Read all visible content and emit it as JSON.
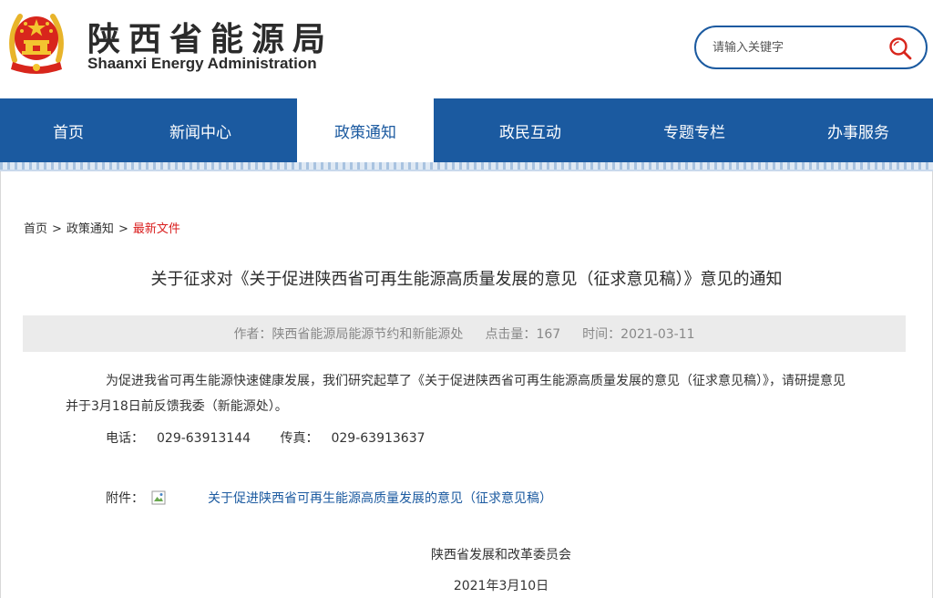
{
  "header": {
    "title": "陕西省能源局",
    "subtitle": "Shaanxi Energy Administration",
    "emblem_icon": "national-emblem-icon"
  },
  "search": {
    "placeholder": "请输入关键字",
    "icon": "search-icon"
  },
  "nav": {
    "items": [
      {
        "label": "首页",
        "active": false
      },
      {
        "label": "新闻中心",
        "active": false
      },
      {
        "label": "政策通知",
        "active": true
      },
      {
        "label": "政民互动",
        "active": false
      },
      {
        "label": "专题专栏",
        "active": false
      },
      {
        "label": "办事服务",
        "active": false
      }
    ]
  },
  "breadcrumb": {
    "items": [
      "首页",
      "政策通知"
    ],
    "separator": ">",
    "current": "最新文件"
  },
  "article": {
    "title": "关于征求对《关于促进陕西省可再生能源高质量发展的意见（征求意见稿）》意见的通知",
    "meta": {
      "author_label": "作者：",
      "author": "陕西省能源局能源节约和新能源处",
      "clicks_label": "点击量：",
      "clicks": "167",
      "time_label": "时间：",
      "time": "2021-03-11"
    },
    "paragraph": "为促进我省可再生能源快速健康发展，我们研究起草了《关于促进陕西省可再生能源高质量发展的意见（征求意见稿）》，请研提意见并于3月18日前反馈我委（新能源处）。",
    "contact": {
      "phone_label": "电话：",
      "phone": "029-63913144",
      "fax_label": "传真：",
      "fax": "029-63913637"
    },
    "attachment": {
      "label": "附件：",
      "icon": "broken-image-icon",
      "link_text": "关于促进陕西省可再生能源高质量发展的意见（征求意见稿）"
    },
    "signature": {
      "org": "陕西省发展和改革委员会",
      "date": "2021年3月10日"
    }
  },
  "colors": {
    "brand_blue": "#1b5aa0",
    "breadcrumb_current": "#d91d1d",
    "meta_bg": "#ebebeb",
    "emblem_red": "#d8261c",
    "emblem_gold": "#f3c530"
  }
}
